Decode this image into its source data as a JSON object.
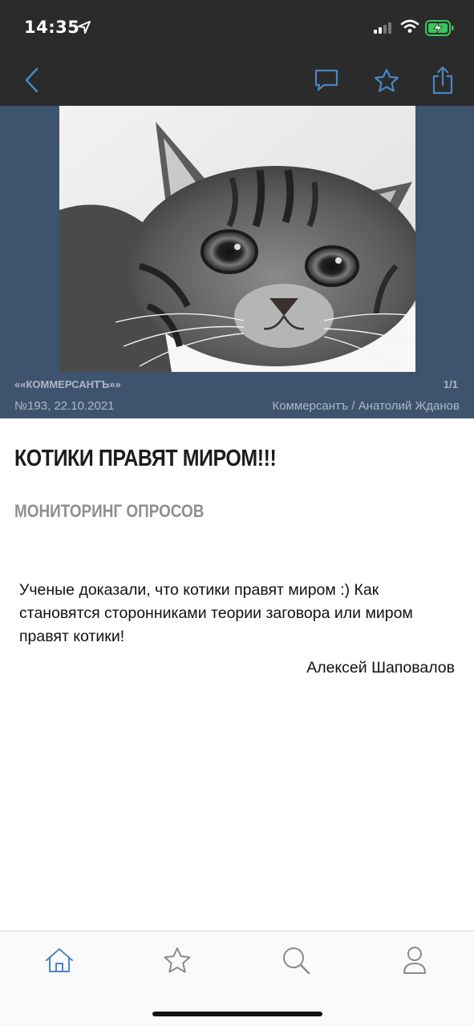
{
  "status_bar": {
    "time": "14:35",
    "icons": [
      "location-arrow-icon",
      "cellular-signal-icon",
      "wifi-icon",
      "battery-charging-icon"
    ]
  },
  "nav_bar": {
    "icons": [
      "back-chevron-icon",
      "comment-icon",
      "star-icon",
      "share-icon"
    ]
  },
  "hero": {
    "background_color": "#3e536e",
    "image": "cat-photo",
    "source": "««КОММЕРСАНТЪ»»",
    "page_counter": "1/1",
    "issue": "№193, 22.10.2021",
    "credit": "Коммерсантъ / Анатолий Жданов"
  },
  "article": {
    "title": "КОТИКИ ПРАВЯТ МИРОМ!!!",
    "rubric": "МОНИТОРИНГ ОПРОСОВ",
    "body": "Ученые доказали, что котики правят миром :) Как становятся сторонниками теории заговора или миром правят котики!",
    "author": "Алексей Шаповалов"
  },
  "tab_bar": {
    "accent_color": "#4a86c5",
    "tabs": [
      {
        "icon": "home-icon",
        "active": true
      },
      {
        "icon": "star-icon",
        "active": false
      },
      {
        "icon": "search-icon",
        "active": false
      },
      {
        "icon": "profile-icon",
        "active": false
      }
    ]
  }
}
